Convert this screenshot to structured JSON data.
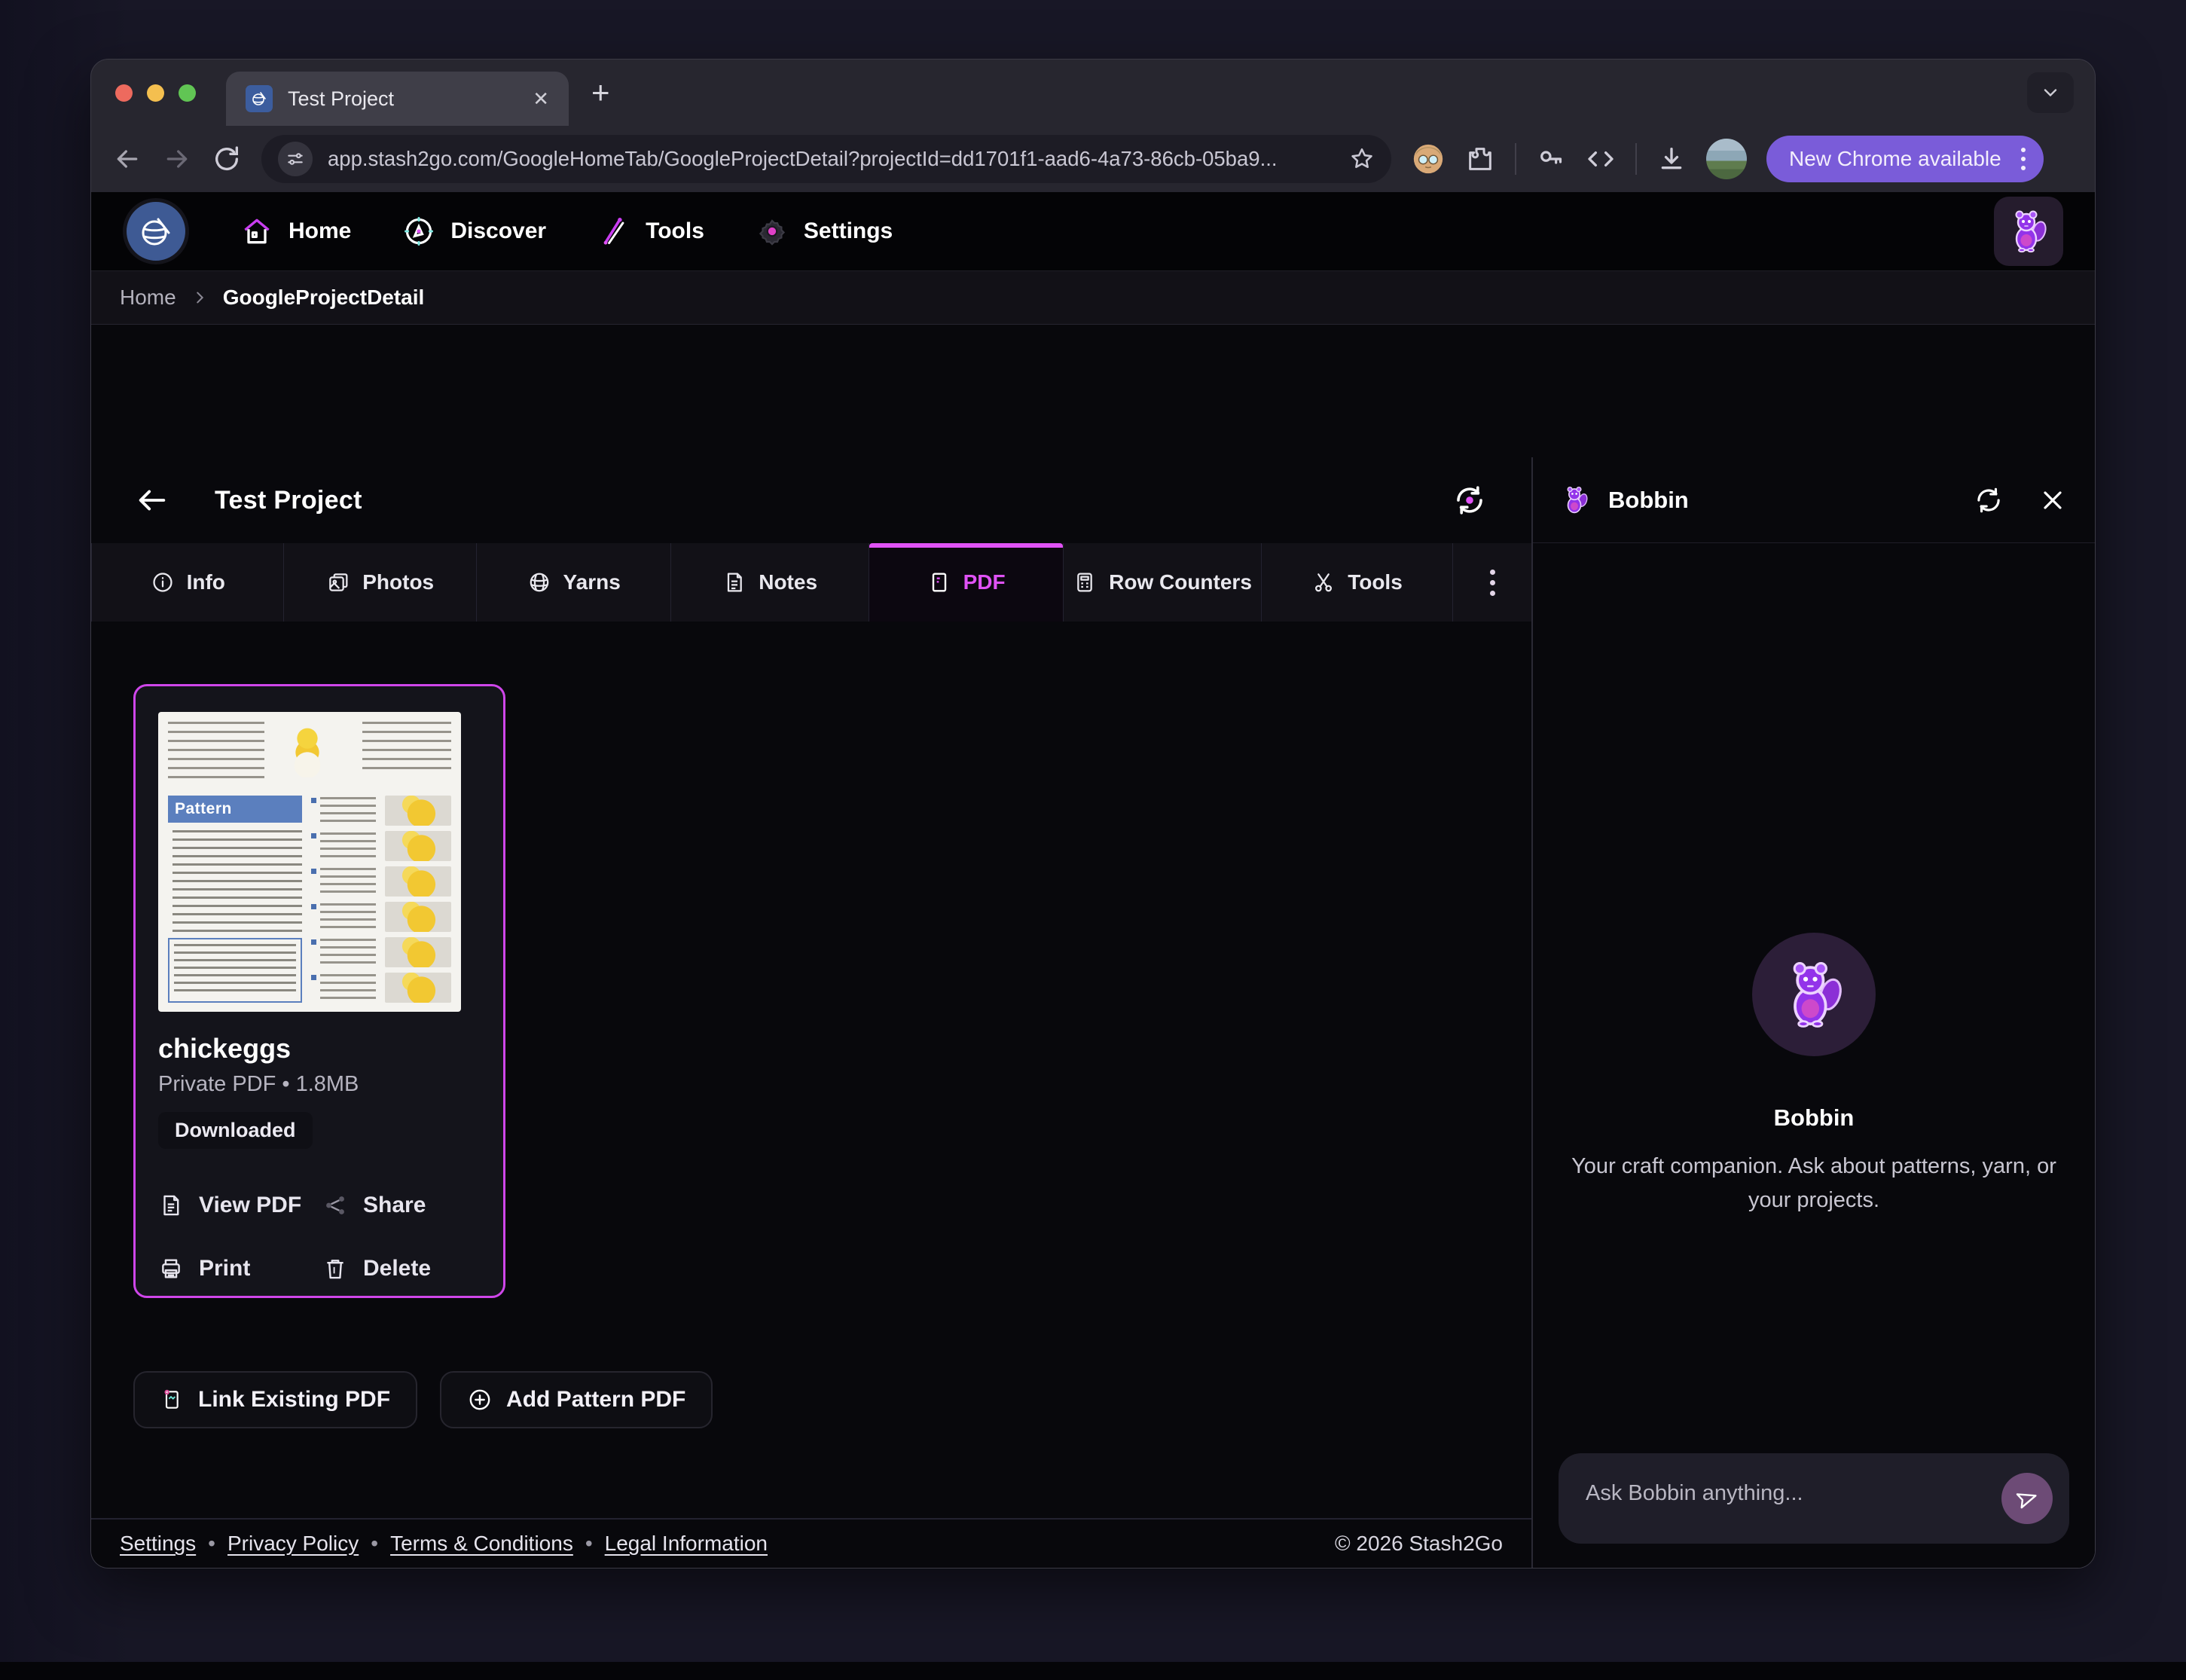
{
  "browser": {
    "tab_title": "Test Project",
    "url": "app.stash2go.com/GoogleHomeTab/GoogleProjectDetail?projectId=dd1701f1-aad6-4a73-86cb-05ba9...",
    "update_button": "New Chrome available"
  },
  "nav": {
    "home": "Home",
    "discover": "Discover",
    "tools": "Tools",
    "settings": "Settings"
  },
  "breadcrumb": {
    "root": "Home",
    "current": "GoogleProjectDetail"
  },
  "page": {
    "title": "Test Project"
  },
  "tabs": {
    "info": "Info",
    "photos": "Photos",
    "yarns": "Yarns",
    "notes": "Notes",
    "pdf": "PDF",
    "row_counters": "Row Counters",
    "tools": "Tools"
  },
  "pdf_card": {
    "thumbnail_banner": "Pattern",
    "title": "chickeggs",
    "meta": "Private PDF • 1.8MB",
    "badge": "Downloaded",
    "view": "View PDF",
    "share": "Share",
    "print": "Print",
    "delete": "Delete"
  },
  "actions": {
    "link_existing": "Link Existing PDF",
    "add_pattern": "Add Pattern PDF"
  },
  "bobbin": {
    "panel_title": "Bobbin",
    "name": "Bobbin",
    "description": "Your craft companion. Ask about patterns, yarn, or your projects.",
    "input_placeholder": "Ask Bobbin anything..."
  },
  "footer": {
    "links": [
      "Settings",
      "Privacy Policy",
      "Terms & Conditions",
      "Legal Information"
    ],
    "separator": "•",
    "copyright": "© 2026 Stash2Go"
  },
  "colors": {
    "accent_magenta": "#e052f5",
    "card_border": "#cf46ea",
    "update_pill_purple": "#7a5cd9",
    "pattern_banner_blue": "#5b7fbe",
    "send_button_purple": "#6d4b76"
  }
}
